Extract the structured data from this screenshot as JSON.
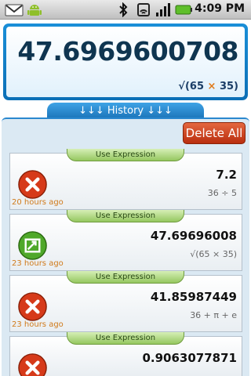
{
  "status_bar": {
    "time": "4:09 PM",
    "icons_left": [
      "gmail-icon",
      "android-icon"
    ],
    "icons_right": [
      "bluetooth-icon",
      "data-sync-icon",
      "signal-icon",
      "battery-icon"
    ]
  },
  "display": {
    "result": "47.6969600708",
    "expression_prefix": "√(65 ",
    "expression_operator": "×",
    "expression_suffix": " 35)"
  },
  "history": {
    "header_label": "↓↓↓ History ↓↓↓",
    "delete_all_label": "Delete All",
    "use_label": "Use Expression",
    "items": [
      {
        "result": "7.2",
        "expression": "36 ÷ 5",
        "time": "20 hours ago",
        "icon": "delete-icon"
      },
      {
        "result": "47.69696008",
        "expression": "√(65 × 35)",
        "time": "23 hours ago",
        "icon": "graph-icon"
      },
      {
        "result": "41.85987449",
        "expression": "36 + π + e",
        "time": "23 hours ago",
        "icon": "delete-icon"
      },
      {
        "result": "0.9063077871",
        "expression": "",
        "time": "",
        "icon": "delete-icon"
      }
    ]
  },
  "colors": {
    "accent": "#1a8fd8",
    "delete": "#c43d1a",
    "use_tab": "#95c760",
    "time_text": "#d07a1a"
  }
}
